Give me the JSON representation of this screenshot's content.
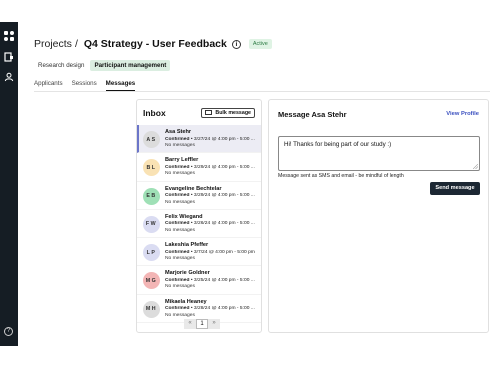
{
  "breadcrumb": {
    "root": "Projects",
    "separator": "/"
  },
  "project": {
    "title": "Q4 Strategy - User Feedback",
    "status": "Active"
  },
  "subtabs": [
    "Research design",
    "Participant management"
  ],
  "tabs": [
    "Applicants",
    "Sessions",
    "Messages"
  ],
  "inbox": {
    "title": "Inbox",
    "bulk_label": "Bulk message",
    "items": [
      {
        "initials": "AS",
        "name": "Asa Stehr",
        "status": "Confirmed",
        "when": " • 3/27/24 @ 4:00 pm - 5:00 ...",
        "preview": "No messages",
        "color": "#dcdcdc"
      },
      {
        "initials": "BL",
        "name": "Barry Leffler",
        "status": "Confirmed",
        "when": " • 3/29/24 @ 4:00 pm - 5:00 ...",
        "preview": "No messages",
        "color": "#f9e2b4"
      },
      {
        "initials": "EB",
        "name": "Evangeline Bechtelar",
        "status": "Confirmed",
        "when": " • 3/29/24 @ 4:00 pm - 5:00 ...",
        "preview": "No messages",
        "color": "#9fe0b6"
      },
      {
        "initials": "FW",
        "name": "Felix Wiegand",
        "status": "Confirmed",
        "when": " • 3/26/24 @ 4:00 pm - 5:00 ...",
        "preview": "No messages",
        "color": "#dadcf2"
      },
      {
        "initials": "LP",
        "name": "Lakeshia Pfeffer",
        "status": "Confirmed",
        "when": " • 3/7/24 @ 4:00 pm - 5:00 pm",
        "preview": "No messages",
        "color": "#dadcf2"
      },
      {
        "initials": "MG",
        "name": "Marjorie Goldner",
        "status": "Confirmed",
        "when": " • 3/25/24 @ 4:00 pm - 5:00 ...",
        "preview": "No messages",
        "color": "#f3b5b5"
      },
      {
        "initials": "MH",
        "name": "Mikaela Heaney",
        "status": "Confirmed",
        "when": " • 3/28/24 @ 4:00 pm - 5:00 ...",
        "preview": "No messages",
        "color": "#dcdcdc"
      }
    ],
    "pagination": {
      "prev": "«",
      "current": "1",
      "next": "»"
    }
  },
  "detail": {
    "title": "Message Asa Stehr",
    "view_profile": "View Profile",
    "message": "Hi! Thanks for being part of our study :)",
    "hint": "Message sent as SMS and email - be mindful of length",
    "send_label": "Send message"
  },
  "icons": {
    "logo": "app-logo",
    "nav": [
      "projects-icon",
      "participants-icon"
    ],
    "help": "help-icon"
  },
  "colors": {
    "rail": "#151d24",
    "accent": "#3a4fbf",
    "active_badge": "#dff3e4",
    "send_button": "#1c2733"
  }
}
